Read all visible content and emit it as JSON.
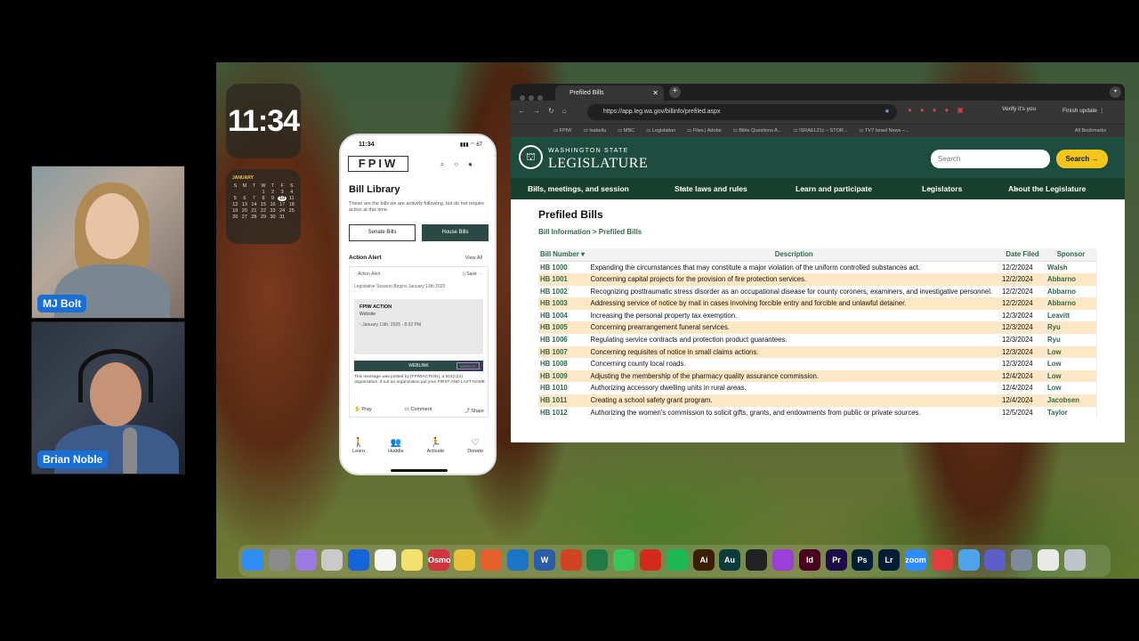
{
  "widgets": {
    "clock": "11:34",
    "calendar": {
      "month": "JANUARY",
      "weekdays": [
        "S",
        "M",
        "T",
        "W",
        "T",
        "F",
        "S"
      ],
      "days": [
        "",
        "",
        "",
        "1",
        "2",
        "3",
        "4",
        "5",
        "6",
        "7",
        "8",
        "9",
        "10",
        "11",
        "12",
        "13",
        "14",
        "15",
        "16",
        "17",
        "18",
        "19",
        "20",
        "21",
        "22",
        "23",
        "24",
        "25",
        "26",
        "27",
        "28",
        "29",
        "30",
        "31",
        ""
      ],
      "today": "10"
    }
  },
  "participants": [
    {
      "name": "MJ Bolt"
    },
    {
      "name": "Brian Noble"
    }
  ],
  "phone": {
    "time": "11:34",
    "battery": "67",
    "logo": "FPIW",
    "title": "Bill Library",
    "description": "These are the bills we are actively following, but do not require action at this time.",
    "senate_btn": "Senate Bills",
    "house_btn": "House Bills",
    "section": "Action Alert",
    "view_all": "View All",
    "card": {
      "type": "Action Alert",
      "save": "Save",
      "subtitle": "Legislative Session Begins January 13th 2025",
      "inner_title": "FPIW ACTION",
      "inner_sub": "Website",
      "inner_date": "January 13th, 2025 - 8:32 PM",
      "weblink": "WEBLINK",
      "weblink_tag": "WEBSITE",
      "note": "This message was posted by [FPIWACTION], a 501(c)(4) organization. If not an organization put your FIRST AND LAST NAME",
      "pray": "Pray",
      "comment": "Comment",
      "share": "Share"
    },
    "nav": [
      "Learn",
      "Huddle",
      "Activate",
      "Donate"
    ]
  },
  "browser": {
    "tab_title": "Prefiled Bills",
    "url": "https://app.leg.wa.gov/billinfo/prefiled.aspx",
    "profile": "Verify it's you",
    "finish_update": "Finish update",
    "bookmarks": [
      "FPIW",
      "Isabella",
      "MBC",
      "Legislation",
      "Files | Adobe",
      "Bible Questions A...",
      "ISRAEL21c – STOR...",
      "TV7 Israel News –..."
    ],
    "all_bookmarks": "All Bookmarks"
  },
  "site": {
    "state": "WASHINGTON STATE",
    "name": "LEGISLATURE",
    "search_placeholder": "Search",
    "search_btn": "Search →",
    "nav": [
      "Bills, meetings, and session",
      "State laws and rules",
      "Learn and participate",
      "Legislators",
      "About the Legislature"
    ],
    "page_title": "Prefiled Bills",
    "breadcrumb": "Bill Information > Prefiled Bills",
    "columns": [
      "Bill Number",
      "Description",
      "Date Filed",
      "Sponsor"
    ],
    "rows": [
      {
        "num": "HB 1000",
        "desc": "Expanding the circumstances that may constitute a major violation of the uniform controlled substances act.",
        "date": "12/2/2024",
        "sponsor": "Walsh"
      },
      {
        "num": "HB 1001",
        "desc": "Concerning capital projects for the provision of fire protection services.",
        "date": "12/2/2024",
        "sponsor": "Abbarno"
      },
      {
        "num": "HB 1002",
        "desc": "Recognizing posttraumatic stress disorder as an occupational disease for county coroners, examiners, and investigative personnel.",
        "date": "12/2/2024",
        "sponsor": "Abbarno"
      },
      {
        "num": "HB 1003",
        "desc": "Addressing service of notice by mail in cases involving forcible entry and forcible and unlawful detainer.",
        "date": "12/2/2024",
        "sponsor": "Abbarno"
      },
      {
        "num": "HB 1004",
        "desc": "Increasing the personal property tax exemption.",
        "date": "12/3/2024",
        "sponsor": "Leavitt"
      },
      {
        "num": "HB 1005",
        "desc": "Concerning prearrangement funeral services.",
        "date": "12/3/2024",
        "sponsor": "Ryu"
      },
      {
        "num": "HB 1006",
        "desc": "Regulating service contracts and protection product guarantees.",
        "date": "12/3/2024",
        "sponsor": "Ryu"
      },
      {
        "num": "HB 1007",
        "desc": "Concerning requisites of notice in small claims actions.",
        "date": "12/3/2024",
        "sponsor": "Low"
      },
      {
        "num": "HB 1008",
        "desc": "Concerning county local roads.",
        "date": "12/3/2024",
        "sponsor": "Low"
      },
      {
        "num": "HB 1009",
        "desc": "Adjusting the membership of the pharmacy quality assurance commission.",
        "date": "12/4/2024",
        "sponsor": "Low"
      },
      {
        "num": "HB 1010",
        "desc": "Authorizing accessory dwelling units in rural areas.",
        "date": "12/4/2024",
        "sponsor": "Low"
      },
      {
        "num": "HB 1011",
        "desc": "Creating a school safety grant program.",
        "date": "12/4/2024",
        "sponsor": "Jacobsen"
      },
      {
        "num": "HB 1012",
        "desc": "Authorizing the women's commission to solicit gifts, grants, and endowments from public or private sources.",
        "date": "12/5/2024",
        "sponsor": "Taylor"
      }
    ]
  },
  "dock": [
    {
      "name": "finder",
      "label": "",
      "color": "#2f8ef5"
    },
    {
      "name": "launchpad",
      "label": "",
      "color": "#8a8a8a"
    },
    {
      "name": "apps",
      "label": "",
      "color": "#9b7be0"
    },
    {
      "name": "notes-app",
      "label": "",
      "color": "#c9c9c9"
    },
    {
      "name": "zoom-alt",
      "label": "",
      "color": "#1565d8"
    },
    {
      "name": "notes",
      "label": "",
      "color": "#f5f5f0"
    },
    {
      "name": "stickies",
      "label": "",
      "color": "#f4e06c"
    },
    {
      "name": "osmo",
      "label": "Osmo",
      "color": "#d0343f"
    },
    {
      "name": "chrome",
      "label": "",
      "color": "#e8c23a"
    },
    {
      "name": "brave",
      "label": "",
      "color": "#e6602e"
    },
    {
      "name": "outlook",
      "label": "",
      "color": "#1d74c9"
    },
    {
      "name": "word",
      "label": "W",
      "color": "#2a5caa"
    },
    {
      "name": "powerpoint",
      "label": "",
      "color": "#d04423"
    },
    {
      "name": "excel",
      "label": "",
      "color": "#1f7a45"
    },
    {
      "name": "messages",
      "label": "",
      "color": "#35c75a"
    },
    {
      "name": "acrobat",
      "label": "",
      "color": "#d42a1c"
    },
    {
      "name": "spotify",
      "label": "",
      "color": "#1db954"
    },
    {
      "name": "illustrator",
      "label": "Ai",
      "color": "#3a1f05"
    },
    {
      "name": "audition",
      "label": "Au",
      "color": "#0b3b3a"
    },
    {
      "name": "piano",
      "label": "",
      "color": "#222222"
    },
    {
      "name": "clipchamp",
      "label": "",
      "color": "#9c3fd6"
    },
    {
      "name": "indesign",
      "label": "Id",
      "color": "#49021f"
    },
    {
      "name": "premiere",
      "label": "Pr",
      "color": "#1e0b47"
    },
    {
      "name": "photoshop",
      "label": "Ps",
      "color": "#001e36"
    },
    {
      "name": "lightroom",
      "label": "Lr",
      "color": "#001d33"
    },
    {
      "name": "zoom",
      "label": "zoom",
      "color": "#2d8cff"
    },
    {
      "name": "remote",
      "label": "",
      "color": "#e33c3c"
    },
    {
      "name": "safari",
      "label": "",
      "color": "#4ea3e8"
    },
    {
      "name": "teams",
      "label": "",
      "color": "#5b5fc7"
    },
    {
      "name": "preview",
      "label": "",
      "color": "#7d8b9c"
    },
    {
      "name": "documents",
      "label": "",
      "color": "#e9e9e9"
    },
    {
      "name": "trash",
      "label": "",
      "color": "#bfc4c9"
    }
  ]
}
